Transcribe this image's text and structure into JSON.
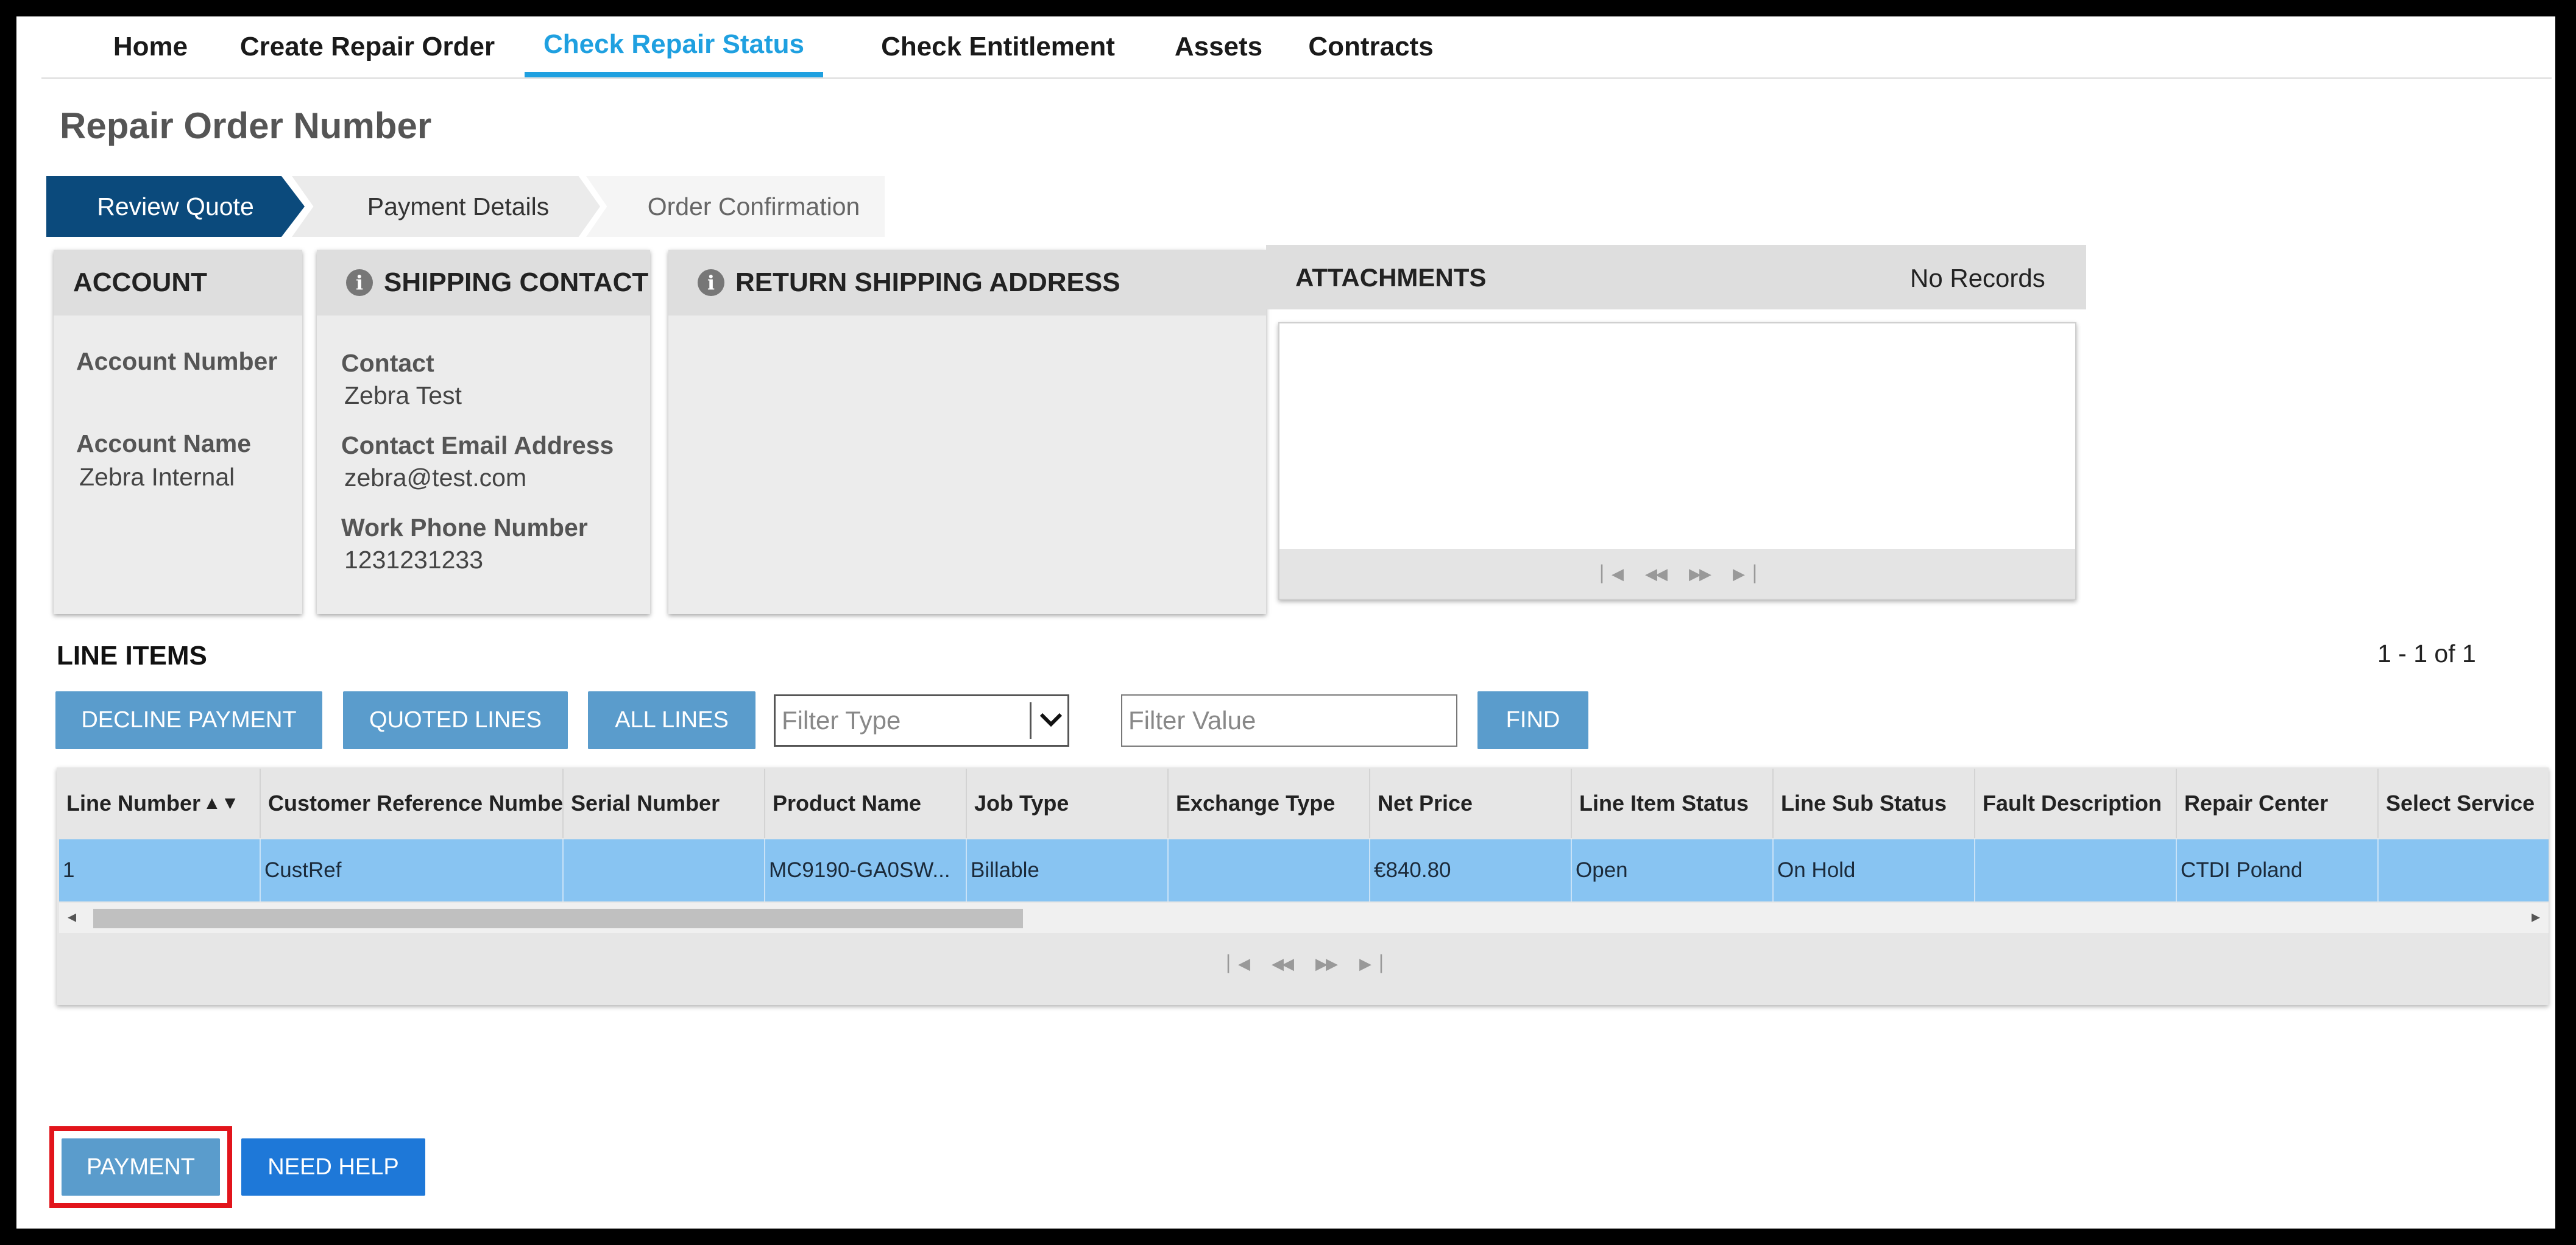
{
  "nav": {
    "tabs": [
      {
        "label": "Home"
      },
      {
        "label": "Create Repair Order"
      },
      {
        "label": "Check Repair Status",
        "active": true
      },
      {
        "label": "Check Entitlement"
      },
      {
        "label": "Assets"
      },
      {
        "label": "Contracts"
      }
    ]
  },
  "page": {
    "title": "Repair Order Number"
  },
  "stepper": {
    "steps": [
      {
        "label": "Review Quote",
        "state": "active"
      },
      {
        "label": "Payment Details",
        "state": "next"
      },
      {
        "label": "Order Confirmation",
        "state": "pending"
      }
    ]
  },
  "account": {
    "header": "ACCOUNT",
    "number_label": "Account Number",
    "number_value": "",
    "name_label": "Account Name",
    "name_value": "Zebra Internal"
  },
  "shipping_contact": {
    "header": "SHIPPING CONTACT",
    "contact_label": "Contact",
    "contact_value": "Zebra Test",
    "email_label": "Contact Email Address",
    "email_value": "zebra@test.com",
    "phone_label": "Work Phone Number",
    "phone_value": "1231231233"
  },
  "return_address": {
    "header": "RETURN SHIPPING ADDRESS"
  },
  "attachments": {
    "header": "ATTACHMENTS",
    "status": "No Records"
  },
  "line_items": {
    "title": "LINE ITEMS",
    "page_info": "1 - 1 of 1",
    "buttons": {
      "decline_payment": "DECLINE PAYMENT",
      "quoted_lines": "QUOTED LINES",
      "all_lines": "ALL LINES",
      "find": "FIND"
    },
    "filter_type_placeholder": "Filter Type",
    "filter_value_placeholder": "Filter Value",
    "columns": [
      "Line Number",
      "Customer Reference Number",
      "Serial Number",
      "Product Name",
      "Job Type",
      "Exchange Type",
      "Net Price",
      "Line Item Status",
      "Line Sub Status",
      "Fault Description",
      "Repair Center",
      "Select Service"
    ],
    "sort_indicator": "▲▼",
    "rows": [
      [
        "1",
        "CustRef",
        "",
        "MC9190-GA0SW...",
        "Billable",
        "",
        "€840.80",
        "Open",
        "On Hold",
        "",
        "CTDI Poland",
        ""
      ]
    ]
  },
  "actions": {
    "payment": "PAYMENT",
    "need_help": "NEED HELP"
  },
  "colors": {
    "active_tab": "#1fa0e0",
    "stepper_active": "#0b4a7c",
    "button": "#5a9ccc",
    "need_help_button": "#1e78d8",
    "selected_row": "#88c4f2",
    "highlight": "#e2141b"
  },
  "icons": {
    "info": "info-icon",
    "pager": [
      "first-page-icon",
      "prev-page-icon",
      "next-page-icon",
      "last-page-icon"
    ],
    "dropdown": "chevron-down-icon"
  }
}
